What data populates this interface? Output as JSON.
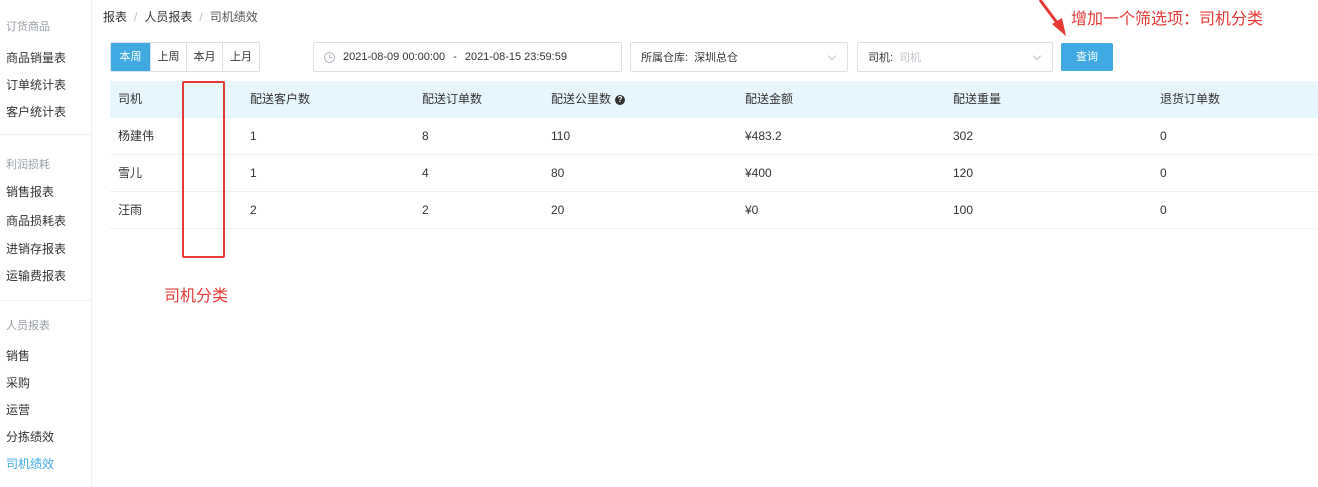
{
  "sidebar": {
    "groups": [
      {
        "title": "订货商品",
        "items": [
          "商品销量表",
          "订单统计表",
          "客户统计表"
        ]
      },
      {
        "title": "利润损耗",
        "items": [
          "销售报表",
          "商品损耗表",
          "进销存报表",
          "运输费报表"
        ]
      },
      {
        "title": "人员报表",
        "items": [
          "销售",
          "采购",
          "运营",
          "分拣绩效",
          "司机绩效"
        ]
      }
    ],
    "active_item": "司机绩效"
  },
  "breadcrumb": {
    "items": [
      "报表",
      "人员报表",
      "司机绩效"
    ],
    "separator": "/"
  },
  "filters": {
    "range_buttons": [
      "本周",
      "上周",
      "本月",
      "上月"
    ],
    "active_range": "本周",
    "date_start": "2021-08-09 00:00:00",
    "date_separator": "-",
    "date_end": "2021-08-15 23:59:59",
    "warehouse_label": "所属仓库:",
    "warehouse_value": "深圳总仓",
    "driver_label": "司机:",
    "driver_placeholder": "司机",
    "query_label": "查询"
  },
  "table": {
    "columns": [
      "司机",
      "配送客户数",
      "配送订单数",
      "配送公里数",
      "配送金额",
      "配送重量",
      "退货订单数"
    ],
    "rows": [
      [
        "杨建伟",
        "1",
        "8",
        "110",
        "¥483.2",
        "302",
        "0"
      ],
      [
        "雪儿",
        "1",
        "4",
        "80",
        "¥400",
        "120",
        "0"
      ],
      [
        "汪雨",
        "2",
        "2",
        "20",
        "¥0",
        "100",
        "0"
      ]
    ]
  },
  "annotations": {
    "column_label": "司机分类",
    "top_note": "增加一个筛选项：司机分类"
  },
  "colors": {
    "accent": "#3fa9e1",
    "header_bg": "#e6f6fc",
    "annotation": "#e53935"
  },
  "icons": [
    "clock-icon",
    "chevron-down-icon",
    "help-icon",
    "arrow-icon"
  ]
}
